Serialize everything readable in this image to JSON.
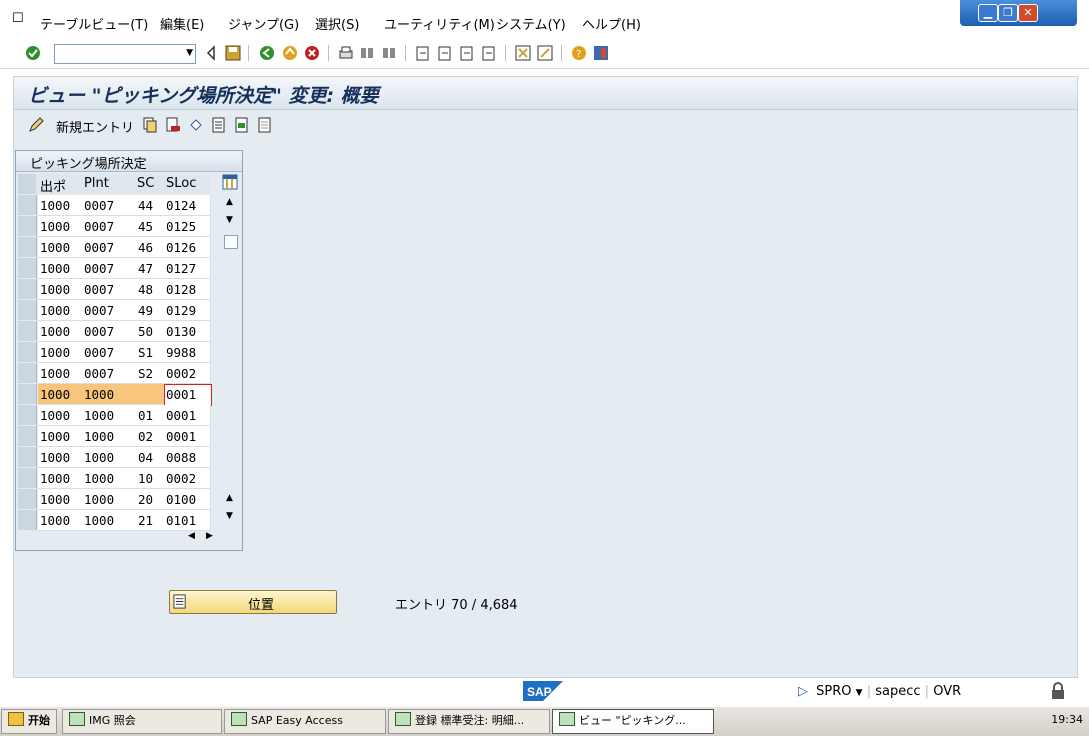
{
  "menubar": {
    "items": [
      "テーブルビュー(T)",
      "編集(E)",
      "ジャンプ(G)",
      "選択(S)",
      "ユーティリティ(M)",
      "システム(Y)",
      "ヘルプ(H)"
    ]
  },
  "title": "ビュー \"ピッキング場所決定\" 変更: 概要",
  "app_toolbar": {
    "new_entries": "新規エントリ"
  },
  "table": {
    "group_title": "ピッキング場所決定",
    "columns": [
      "出ポ",
      "Plnt",
      "SC",
      "SLoc"
    ],
    "rows": [
      [
        "1000",
        "0007",
        "44",
        "0124"
      ],
      [
        "1000",
        "0007",
        "45",
        "0125"
      ],
      [
        "1000",
        "0007",
        "46",
        "0126"
      ],
      [
        "1000",
        "0007",
        "47",
        "0127"
      ],
      [
        "1000",
        "0007",
        "48",
        "0128"
      ],
      [
        "1000",
        "0007",
        "49",
        "0129"
      ],
      [
        "1000",
        "0007",
        "50",
        "0130"
      ],
      [
        "1000",
        "0007",
        "S1",
        "9988"
      ],
      [
        "1000",
        "0007",
        "S2",
        "0002"
      ],
      [
        "1000",
        "1000",
        "",
        "0001"
      ],
      [
        "1000",
        "1000",
        "01",
        "0001"
      ],
      [
        "1000",
        "1000",
        "02",
        "0001"
      ],
      [
        "1000",
        "1000",
        "04",
        "0088"
      ],
      [
        "1000",
        "1000",
        "10",
        "0002"
      ],
      [
        "1000",
        "1000",
        "20",
        "0100"
      ],
      [
        "1000",
        "1000",
        "21",
        "0101"
      ]
    ],
    "highlighted_row": 9
  },
  "position_button": "位置",
  "entry_info": "エントリ 70 / 4,684",
  "statusbar": {
    "logo": "SAP",
    "transaction": "SPRO",
    "server": "sapecc",
    "mode": "OVR"
  },
  "taskbar": {
    "start": "开始",
    "tasks": [
      "IMG 照会",
      "SAP Easy Access",
      "登録 標準受注: 明細...",
      "ビュー \"ピッキング..."
    ],
    "clock": "19:34"
  },
  "colors": {
    "title": "#16305c",
    "highlight": "#f7c57b",
    "background": "#e4ebf1"
  }
}
